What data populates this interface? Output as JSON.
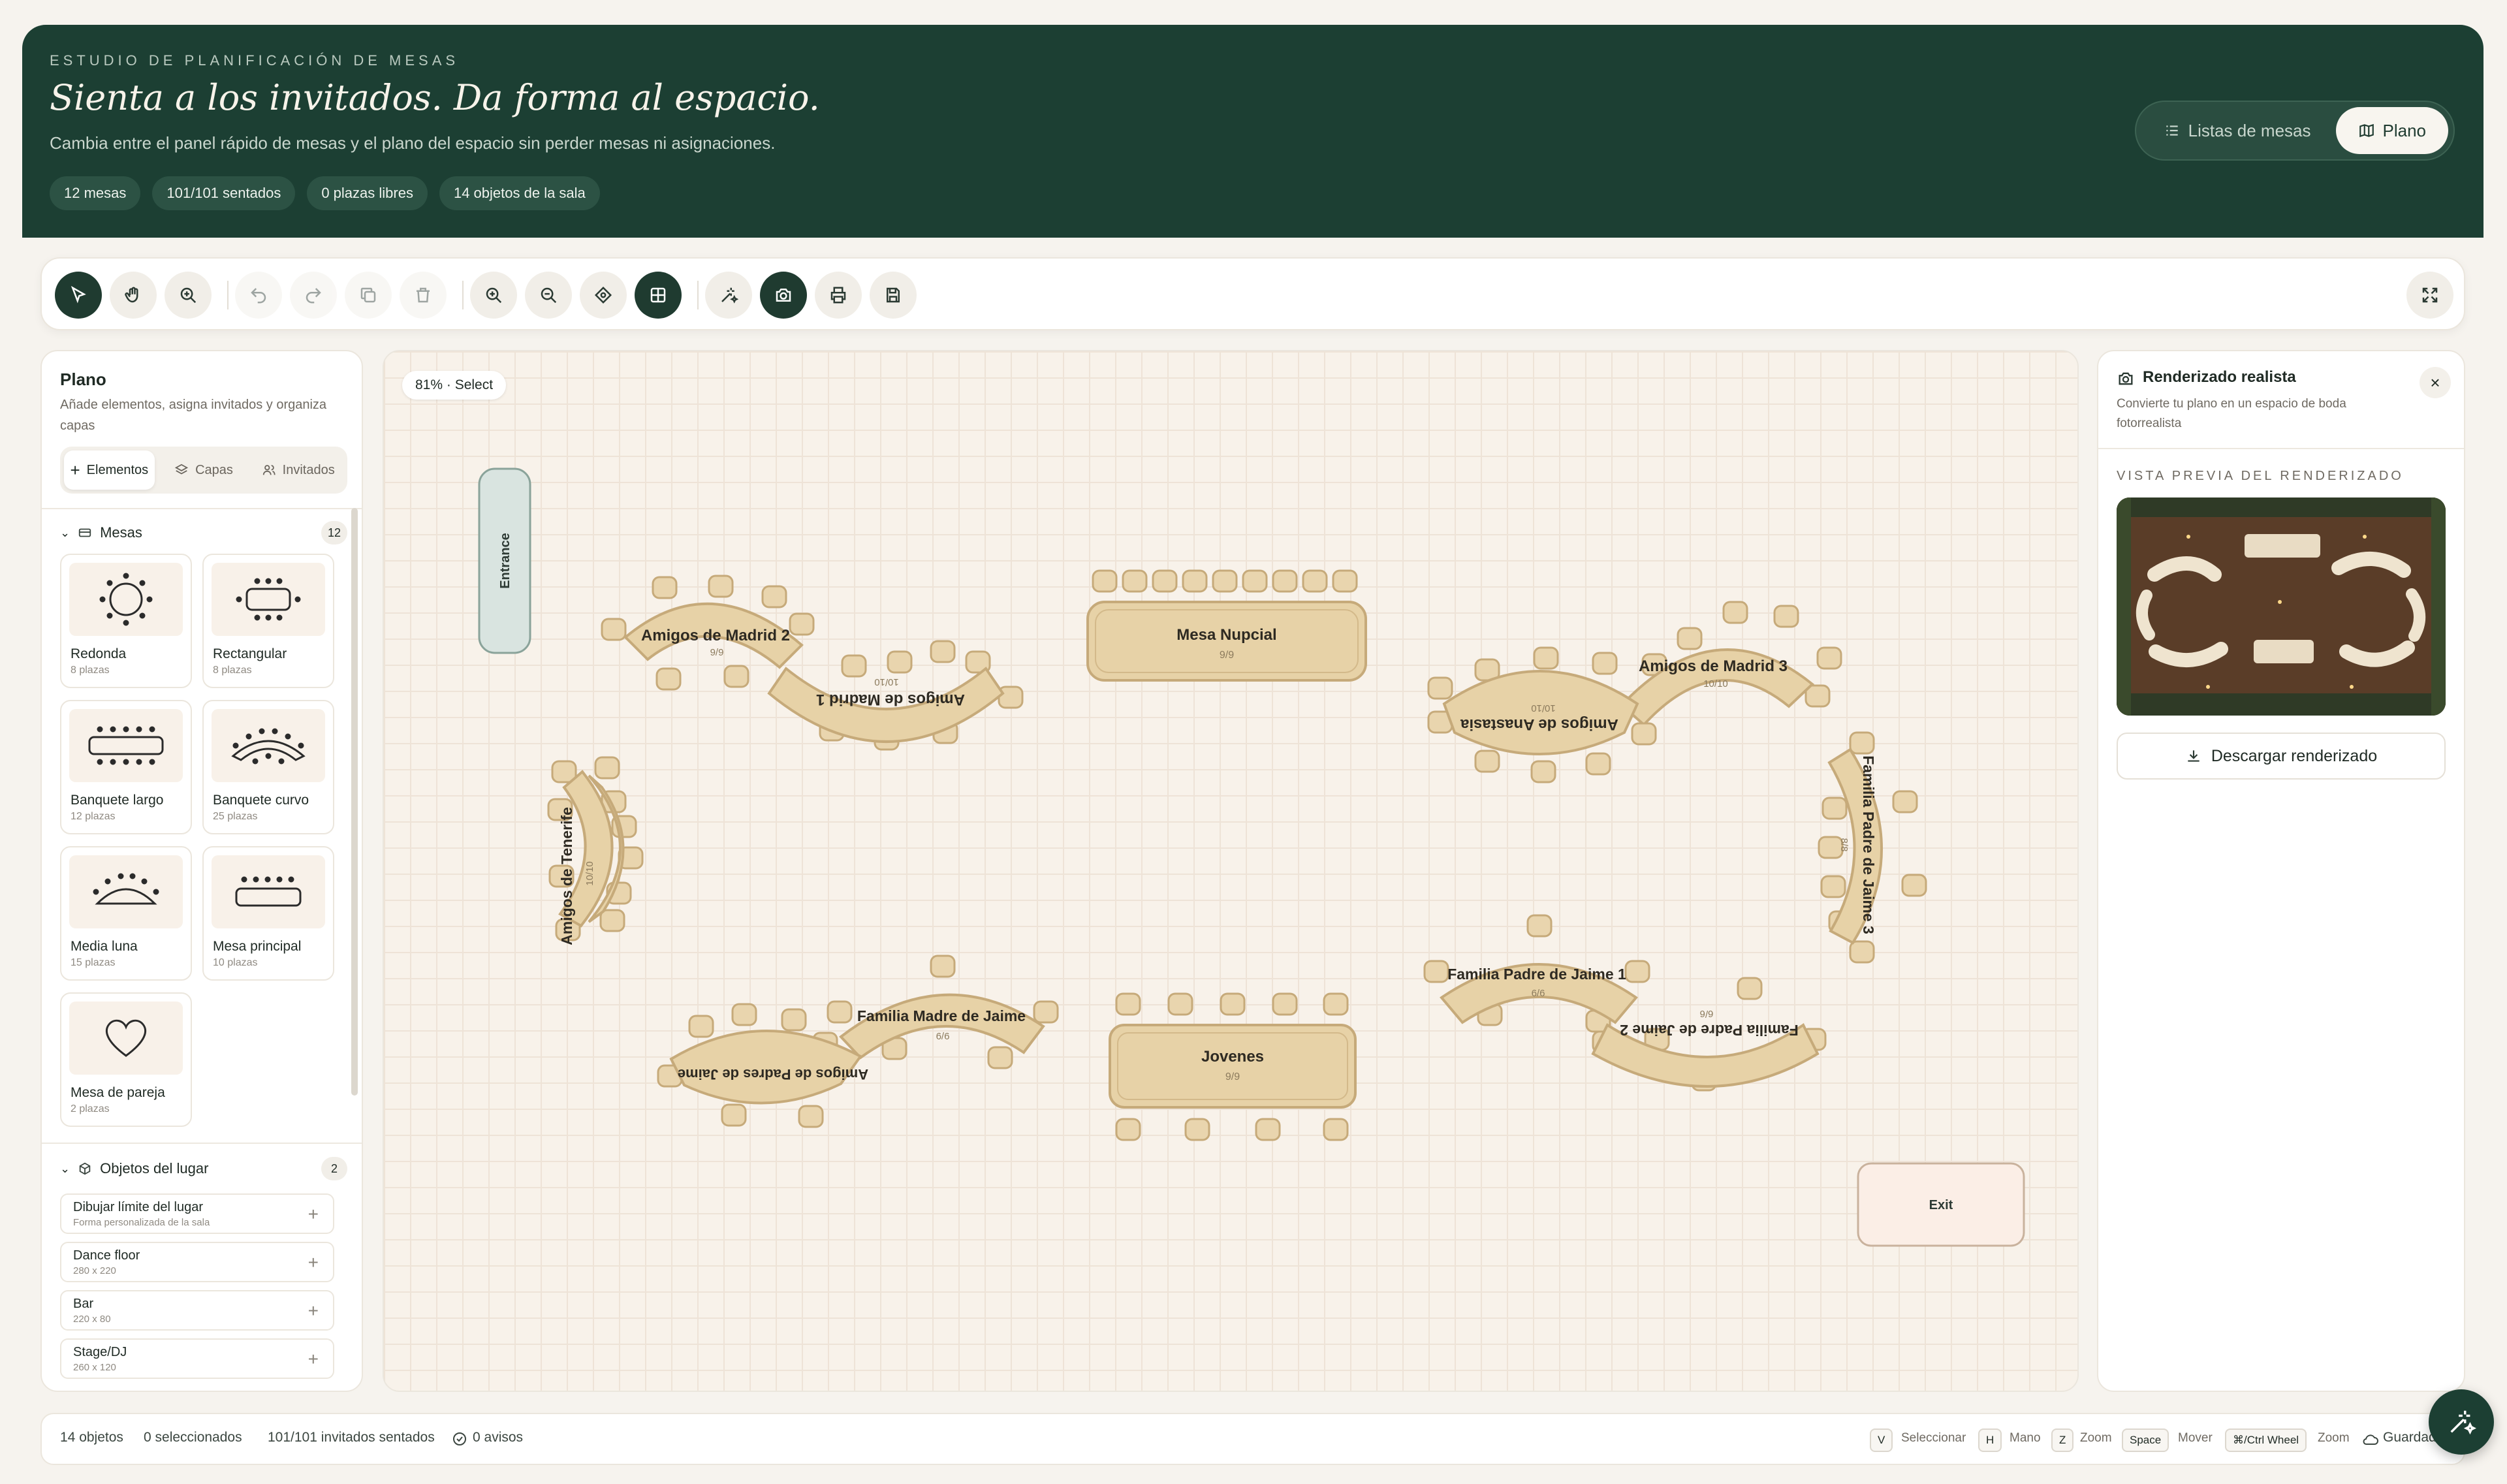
{
  "header": {
    "eyebrow": "ESTUDIO DE PLANIFICACIÓN DE MESAS",
    "title": "Sienta a los invitados. Da forma al espacio.",
    "subtitle": "Cambia entre el panel rápido de mesas y el plano del espacio sin perder mesas ni asignaciones.",
    "stats": [
      "12 mesas",
      "101/101 sentados",
      "0 plazas libres",
      "14 objetos de la sala"
    ],
    "view_toggle": {
      "lists_label": "Listas de mesas",
      "plan_label": "Plano",
      "active": "Plano"
    }
  },
  "toolbar": {
    "tools": [
      "select-tool",
      "hand-tool",
      "zoom-tool",
      "undo",
      "redo",
      "duplicate",
      "delete",
      "zoom-in",
      "zoom-out",
      "fit-view",
      "grid-toggle",
      "magic-arrange",
      "render-camera",
      "print",
      "save"
    ],
    "active_tool": "select-tool",
    "fullscreen": "fullscreen"
  },
  "left_panel": {
    "title": "Plano",
    "description": "Añade elementos, asigna invitados y organiza capas",
    "tabs": [
      "Elementos",
      "Capas",
      "Invitados"
    ],
    "active_tab": "Elementos",
    "tables_section": {
      "label": "Mesas",
      "count": "12"
    },
    "table_types": [
      {
        "name": "Redonda",
        "seats": "8 plazas"
      },
      {
        "name": "Rectangular",
        "seats": "8 plazas"
      },
      {
        "name": "Banquete largo",
        "seats": "12 plazas"
      },
      {
        "name": "Banquete curvo",
        "seats": "25 plazas"
      },
      {
        "name": "Media luna",
        "seats": "15 plazas"
      },
      {
        "name": "Mesa principal",
        "seats": "10 plazas"
      },
      {
        "name": "Mesa de pareja",
        "seats": "2 plazas"
      }
    ],
    "objects_section": {
      "label": "Objetos del lugar",
      "count": "2"
    },
    "objects": [
      {
        "name": "Dibujar límite del lugar",
        "size": "Forma personalizada de la sala"
      },
      {
        "name": "Dance floor",
        "size": "280 x 220"
      },
      {
        "name": "Bar",
        "size": "220 x 80"
      },
      {
        "name": "Stage/DJ",
        "size": "260 x 120"
      }
    ]
  },
  "canvas": {
    "zoom_mode": "81% · Select",
    "tables": [
      {
        "name": "Mesa Nupcial",
        "seats": "9/9"
      },
      {
        "name": "Jovenes",
        "seats": "9/9"
      },
      {
        "name": "Amigos de Madrid 2",
        "seats": "9/9"
      },
      {
        "name": "Amigos de Madrid 1",
        "seats": "10/10"
      },
      {
        "name": "Amigos de Madrid 3",
        "seats": "10/10"
      },
      {
        "name": "Amigos de Anastasia",
        "seats": "10/10"
      },
      {
        "name": "Amigos de Tenerife",
        "seats": "10/10"
      },
      {
        "name": "Familia Padre de Jaime 3",
        "seats": "8/8"
      },
      {
        "name": "Familia Madre de Jaime",
        "seats": "6/6"
      },
      {
        "name": "Amigos de Padres de Jaime",
        "seats": ""
      },
      {
        "name": "Familia Padre de Jaime 1",
        "seats": "6/6"
      },
      {
        "name": "Familia Padre de Jaime 2",
        "seats": "6/6"
      }
    ],
    "objects": [
      {
        "name": "Entrance"
      },
      {
        "name": "Exit"
      }
    ]
  },
  "right_panel": {
    "title": "Renderizado realista",
    "description": "Convierte tu plano en un espacio de boda fotorrealista",
    "preview_label": "VISTA PREVIA DEL RENDERIZADO",
    "download_label": "Descargar renderizado"
  },
  "status_bar": {
    "objects": "14 objetos",
    "selected": "0 seleccionados",
    "seated": "101/101 invitados sentados",
    "warnings": "0 avisos",
    "shortcuts": [
      {
        "key": "V",
        "label": "Seleccionar"
      },
      {
        "key": "H",
        "label": "Mano"
      },
      {
        "key": "Z",
        "label": "Zoom"
      },
      {
        "key": "Space",
        "label": "Mover"
      },
      {
        "key": "⌘/Ctrl Wheel",
        "label": "Zoom"
      }
    ],
    "save_state": "Guardado"
  },
  "colors": {
    "header_bg": "#1c3f33",
    "table_fill": "#e7d2a7",
    "table_stroke": "#c6aa7a",
    "chair_fill": "#e9d5ae",
    "entrance_fill": "#d9e4e0",
    "exit_fill": "#fbeee6"
  }
}
